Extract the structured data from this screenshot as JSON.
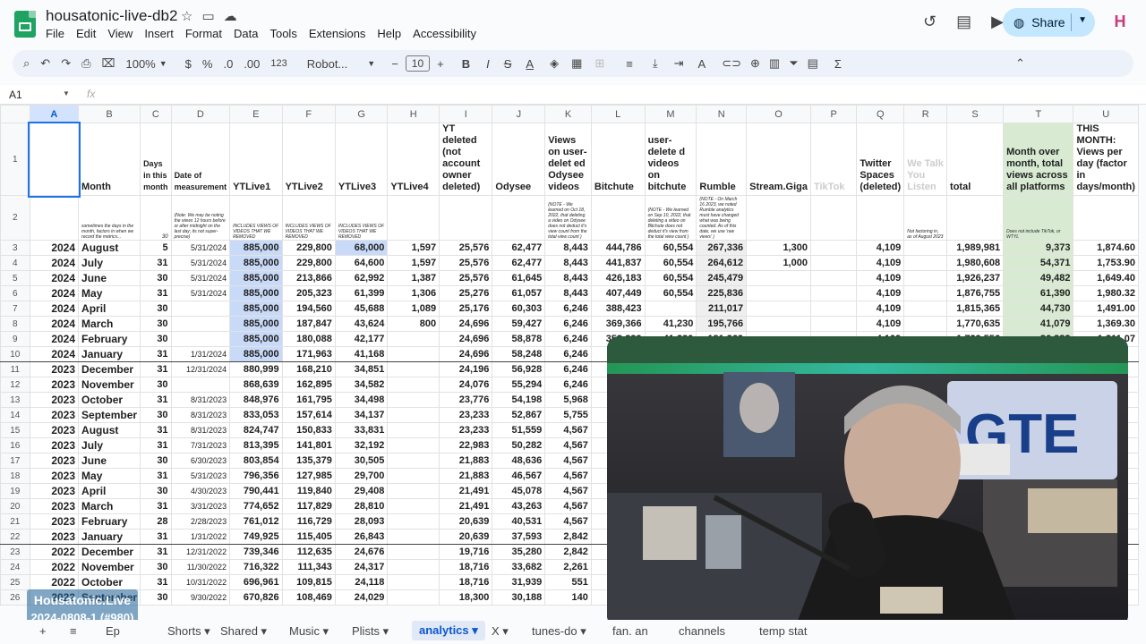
{
  "app": {
    "title": "housatonic-live-db2",
    "share_label": "Share",
    "avatar_letter": "H",
    "menu": [
      "File",
      "Edit",
      "View",
      "Insert",
      "Format",
      "Data",
      "Tools",
      "Extensions",
      "Help",
      "Accessibility"
    ]
  },
  "toolbar": {
    "zoom": "100%",
    "currency": "$",
    "percent": "%",
    "dec_less": ".0",
    "dec_more": ".00",
    "format_num": "123",
    "font": "Robot...",
    "font_size": "10"
  },
  "formula_bar": {
    "cell_ref": "A1",
    "fx": "fx"
  },
  "columns": [
    "A",
    "B",
    "C",
    "D",
    "E",
    "F",
    "G",
    "H",
    "I",
    "J",
    "K",
    "L",
    "M",
    "N",
    "O",
    "P",
    "Q",
    "R",
    "S",
    "T",
    "U"
  ],
  "header_row": [
    "",
    "Month",
    "Days in this month",
    "Date of measurement",
    "YTLive1",
    "YTLive2",
    "YTLive3",
    "YTLive4",
    "YT deleted (not account owner deleted)",
    "Odysee",
    "Views on user-delet ed Odysee videos",
    "Bitchute",
    "user-delete d videos on bitchute",
    "Rumble",
    "Stream.Giga",
    "TikTok",
    "Twitter Spaces (deleted)",
    "We Talk You Listen",
    "total",
    "Month over month, total views across all platforms",
    "THIS MONTH: Views per day (factor in days/month)"
  ],
  "note_row": [
    "",
    "sometimes the days in the month, factors in when we record the metrics...",
    "30",
    "(Note: We may be noting the views 12 hours before or after midnight on the last day; its not super-precise)",
    "INCLUDES VIEWS OF VIDEOS THAT WE REMOVED",
    "INCLUDES VIEWS OF VIDEOS THAT WE REMOVED",
    "INCLUDES VIEWS OF VIDEOS THAT WE REMOVED",
    "",
    "",
    "",
    "(NOTE - We learned on Oct 18, 2022, that deleting a video on Odysee does not deduct it's view count from the total view count )",
    "",
    "(NOTE - We learned on Sep 10, 2022, that deleting a video on Bitchute does not deduct it's view from the total view count )",
    "(NOTE - On March 16 2023, we noted Rumble analytics must have changed what was being counted. As of this date, we use 'raw views' )",
    "",
    "",
    "",
    "Not factoring in, as of August 2023",
    "",
    "Does not include TikTok, or WTYL",
    ""
  ],
  "rows": [
    [
      "3",
      "2024",
      "August",
      "5",
      "5/31/2024",
      "885,000",
      "229,800",
      "68,000",
      "1,597",
      "25,576",
      "62,477",
      "8,443",
      "444,786",
      "60,554",
      "267,336",
      "1,300",
      "",
      "4,109",
      "",
      "1,989,981",
      "9,373",
      "1,874.60"
    ],
    [
      "4",
      "2024",
      "July",
      "31",
      "5/31/2024",
      "885,000",
      "229,800",
      "64,600",
      "1,597",
      "25,576",
      "62,477",
      "8,443",
      "441,837",
      "60,554",
      "264,612",
      "1,000",
      "",
      "4,109",
      "",
      "1,980,608",
      "54,371",
      "1,753.90"
    ],
    [
      "5",
      "2024",
      "June",
      "30",
      "5/31/2024",
      "885,000",
      "213,866",
      "62,992",
      "1,387",
      "25,576",
      "61,645",
      "8,443",
      "426,183",
      "60,554",
      "245,479",
      "",
      "",
      "4,109",
      "",
      "1,926,237",
      "49,482",
      "1,649.40"
    ],
    [
      "6",
      "2024",
      "May",
      "31",
      "5/31/2024",
      "885,000",
      "205,323",
      "61,399",
      "1,306",
      "25,276",
      "61,057",
      "8,443",
      "407,449",
      "60,554",
      "225,836",
      "",
      "",
      "4,109",
      "",
      "1,876,755",
      "61,390",
      "1,980.32"
    ],
    [
      "7",
      "2024",
      "April",
      "30",
      "",
      "885,000",
      "194,560",
      "45,688",
      "1,089",
      "25,176",
      "60,303",
      "6,246",
      "388,423",
      "",
      "211,017",
      "",
      "",
      "4,109",
      "",
      "1,815,365",
      "44,730",
      "1,491.00"
    ],
    [
      "8",
      "2024",
      "March",
      "30",
      "",
      "885,000",
      "187,847",
      "43,624",
      "800",
      "24,696",
      "59,427",
      "6,246",
      "369,366",
      "41,230",
      "195,766",
      "",
      "",
      "4,109",
      "",
      "1,770,635",
      "41,079",
      "1,369.30"
    ],
    [
      "9",
      "2024",
      "February",
      "30",
      "",
      "885,000",
      "180,088",
      "42,177",
      "",
      "24,696",
      "58,878",
      "6,246",
      "353,239",
      "41,230",
      "181,369",
      "",
      "",
      "4,109",
      "",
      "1,729,556",
      "36,332",
      "1,211.07"
    ],
    [
      "10",
      "2024",
      "January",
      "31",
      "1/31/2024",
      "885,000",
      "171,963",
      "41,168",
      "",
      "24,696",
      "58,248",
      "6,246",
      "",
      "",
      "",
      "",
      "",
      "",
      "",
      "",
      "",
      ""
    ],
    [
      "11",
      "2023",
      "December",
      "31",
      "12/31/2024",
      "880,999",
      "168,210",
      "34,851",
      "",
      "24,196",
      "56,928",
      "6,246",
      "",
      "",
      "",
      "",
      "",
      "",
      "",
      "",
      "",
      ""
    ],
    [
      "12",
      "2023",
      "November",
      "30",
      "",
      "868,639",
      "162,895",
      "34,582",
      "",
      "24,076",
      "55,294",
      "6,246",
      "",
      "",
      "",
      "",
      "",
      "",
      "",
      "",
      "",
      ""
    ],
    [
      "13",
      "2023",
      "October",
      "31",
      "8/31/2023",
      "848,976",
      "161,795",
      "34,498",
      "",
      "23,776",
      "54,198",
      "5,968",
      "",
      "",
      "",
      "",
      "",
      "",
      "",
      "",
      "",
      ""
    ],
    [
      "14",
      "2023",
      "September",
      "30",
      "8/31/2023",
      "833,053",
      "157,614",
      "34,137",
      "",
      "23,233",
      "52,867",
      "5,755",
      "",
      "",
      "",
      "",
      "",
      "",
      "",
      "",
      "",
      ""
    ],
    [
      "15",
      "2023",
      "August",
      "31",
      "8/31/2023",
      "824,747",
      "150,833",
      "33,831",
      "",
      "23,233",
      "51,559",
      "4,567",
      "",
      "",
      "",
      "",
      "",
      "",
      "",
      "",
      "",
      ""
    ],
    [
      "16",
      "2023",
      "July",
      "31",
      "7/31/2023",
      "813,395",
      "141,801",
      "32,192",
      "",
      "22,983",
      "50,282",
      "4,567",
      "",
      "",
      "",
      "",
      "",
      "",
      "",
      "",
      "",
      ""
    ],
    [
      "17",
      "2023",
      "June",
      "30",
      "6/30/2023",
      "803,854",
      "135,379",
      "30,505",
      "",
      "21,883",
      "48,636",
      "4,567",
      "",
      "",
      "",
      "",
      "",
      "",
      "",
      "",
      "",
      ""
    ],
    [
      "18",
      "2023",
      "May",
      "31",
      "5/31/2023",
      "796,356",
      "127,985",
      "29,700",
      "",
      "21,883",
      "46,567",
      "4,567",
      "",
      "",
      "",
      "",
      "",
      "",
      "",
      "",
      "",
      ""
    ],
    [
      "19",
      "2023",
      "April",
      "30",
      "4/30/2023",
      "790,441",
      "119,840",
      "29,408",
      "",
      "21,491",
      "45,078",
      "4,567",
      "",
      "",
      "",
      "",
      "",
      "",
      "",
      "",
      "",
      ""
    ],
    [
      "20",
      "2023",
      "March",
      "31",
      "3/31/2023",
      "774,652",
      "117,829",
      "28,810",
      "",
      "21,491",
      "43,263",
      "4,567",
      "",
      "",
      "",
      "",
      "",
      "",
      "",
      "",
      "",
      ""
    ],
    [
      "21",
      "2023",
      "February",
      "28",
      "2/28/2023",
      "761,012",
      "116,729",
      "28,093",
      "",
      "20,639",
      "40,531",
      "4,567",
      "",
      "",
      "",
      "",
      "",
      "",
      "",
      "",
      "",
      ""
    ],
    [
      "22",
      "2023",
      "January",
      "31",
      "1/31/2022",
      "749,925",
      "115,405",
      "26,843",
      "",
      "20,639",
      "37,593",
      "2,842",
      "",
      "",
      "",
      "",
      "",
      "",
      "",
      "",
      "",
      ""
    ],
    [
      "23",
      "2022",
      "December",
      "31",
      "12/31/2022",
      "739,346",
      "112,635",
      "24,676",
      "",
      "19,716",
      "35,280",
      "2,842",
      "",
      "",
      "",
      "",
      "",
      "",
      "",
      "",
      "",
      ""
    ],
    [
      "24",
      "2022",
      "November",
      "30",
      "11/30/2022",
      "716,322",
      "111,343",
      "24,317",
      "",
      "18,716",
      "33,682",
      "2,261",
      "",
      "",
      "",
      "",
      "",
      "",
      "",
      "",
      "",
      ""
    ],
    [
      "25",
      "2022",
      "October",
      "31",
      "10/31/2022",
      "696,961",
      "109,815",
      "24,118",
      "",
      "18,716",
      "31,939",
      "551",
      "",
      "",
      "",
      "",
      "",
      "",
      "",
      "",
      "",
      ""
    ],
    [
      "26",
      "2022",
      "September",
      "30",
      "9/30/2022",
      "670,826",
      "108,469",
      "24,029",
      "",
      "18,300",
      "30,188",
      "140",
      "",
      "",
      "",
      "",
      "",
      "",
      "",
      "",
      "",
      ""
    ]
  ],
  "sheet_tabs": [
    "+",
    "≡",
    "Ep",
    "Shorts",
    "Shared",
    "Music",
    "Plists",
    "analytics",
    "X",
    "tunes-do",
    "fan. an",
    "channels",
    "temp stat"
  ],
  "active_tab": "analytics",
  "watermark": {
    "line1": "Housatonic.Live",
    "line2": "2024-0808-1 (#980)"
  }
}
